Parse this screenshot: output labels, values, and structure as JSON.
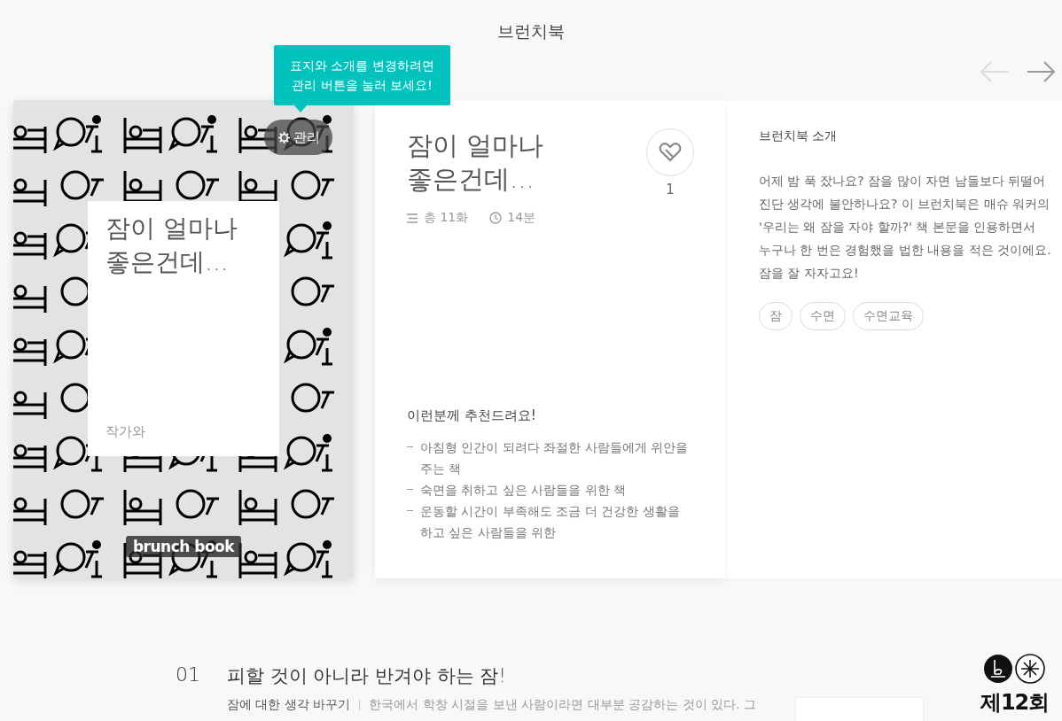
{
  "header": {
    "title": "브런치북"
  },
  "nav": [
    {
      "kind": "prev",
      "disabled": true
    },
    {
      "kind": "next",
      "disabled": false
    }
  ],
  "tooltip": {
    "lines": [
      "표지와 소개를 변경하려면",
      "관리 버튼을 눌러 보세요!"
    ]
  },
  "cover": {
    "manage_button": "관리",
    "title": "잠이 얼마나\n좋은건데...",
    "author": "작가와",
    "logo": "brunch book"
  },
  "summary": {
    "title": "잠이 얼마나\n좋은건데...",
    "likes": "1",
    "episodes": "총 11화",
    "read_time": "14분",
    "recommend_heading": "이런분께 추천드려요!",
    "recommend_items": [
      "아침형 인간이 되려다 좌절한 사람들에게 위안을 주는 책",
      "숙면을 취하고 싶은 사람들을 위한 책",
      "운동할 시간이 부족해도 조금 더 건강한 생활을 하고 싶은 사람들을 위한"
    ]
  },
  "intro": {
    "heading": "브런치북 소개",
    "text": "어제 밤 푹 잤나요? 잠을 많이 자면 남들보다 뒤떨어진단 생각에 불안하나요? 이 브런치북은 매슈 워커의 '우리는 왜 잠을 자야 할까?' 책 본문을 인용하면서 누구나 한 번은 경험했을 법한 내용을 적은 것이에요. 잠을 잘 자자고요!",
    "tags": [
      "잠",
      "수면",
      "수면교육"
    ]
  },
  "episodes": [
    {
      "number": "01",
      "title": "피할 것이 아니라 반겨야 하는 잠!",
      "subtitle": "잠에 대한 생각 바꾸기",
      "excerpt": "한국에서 학창 시절을 보낸 사람이라면 대부분 공감하는 것이 있다. 그"
    }
  ],
  "badge": {
    "text": "제12회"
  }
}
